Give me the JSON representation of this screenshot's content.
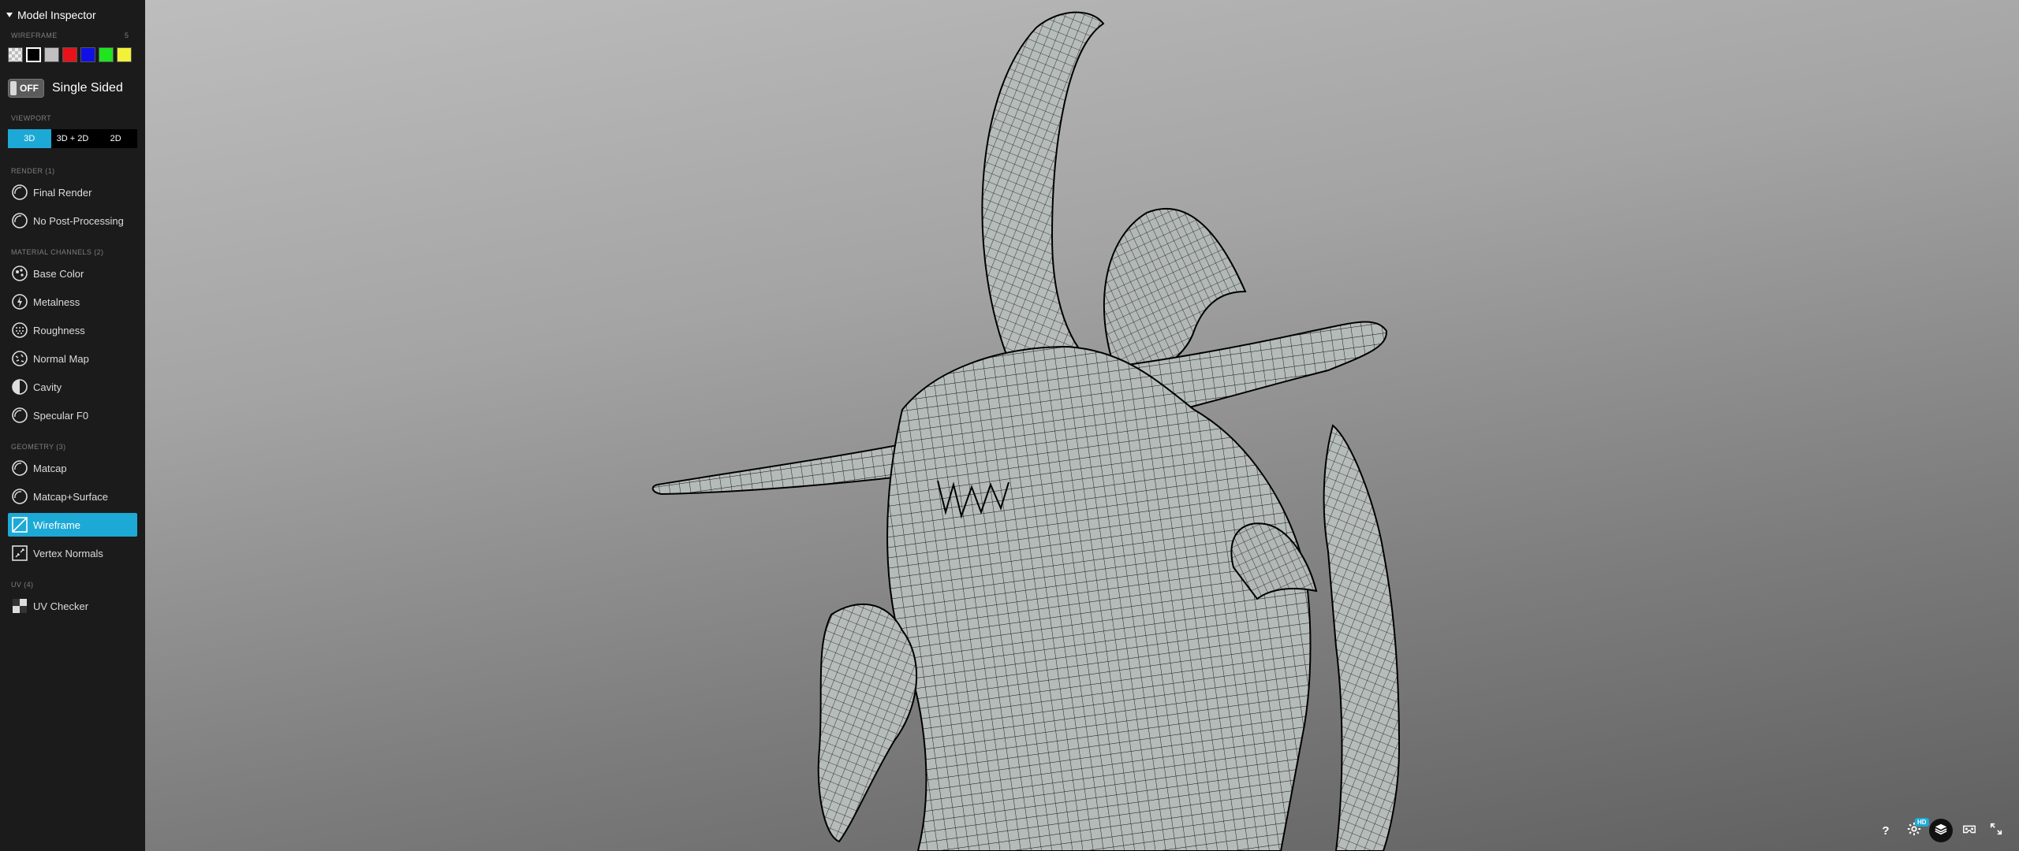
{
  "panel": {
    "title": "Model Inspector",
    "wireframe_label": "WIREFRAME",
    "wireframe_count": "5",
    "single_sided_state": "OFF",
    "single_sided_label": "Single Sided",
    "viewport_label": "VIEWPORT",
    "viewport_options": [
      "3D",
      "3D + 2D",
      "2D"
    ],
    "viewport_selected": "3D",
    "render_label": "RENDER (1)",
    "material_label": "MATERIAL CHANNELS (2)",
    "geometry_label": "GEOMETRY (3)",
    "uv_label": "UV (4)",
    "render_items": [
      "Final Render",
      "No Post-Processing"
    ],
    "material_items": [
      "Base Color",
      "Metalness",
      "Roughness",
      "Normal Map",
      "Cavity",
      "Specular F0"
    ],
    "geometry_items": [
      "Matcap",
      "Matcap+Surface",
      "Wireframe",
      "Vertex Normals"
    ],
    "uv_items": [
      "UV Checker"
    ],
    "active_item": "Wireframe"
  },
  "wireframe_colors": [
    "checker",
    "#000000",
    "#c0c0c0",
    "#e8121a",
    "#1010e6",
    "#1fe41f",
    "#f1f13a"
  ],
  "selected_wireframe_color": "#000000",
  "accent_color": "#1da9d6",
  "toolbar": {
    "help": "?",
    "hd_badge": "HD",
    "icons": [
      "help-icon",
      "settings-icon",
      "layers-icon",
      "vr-icon",
      "fullscreen-icon"
    ]
  }
}
